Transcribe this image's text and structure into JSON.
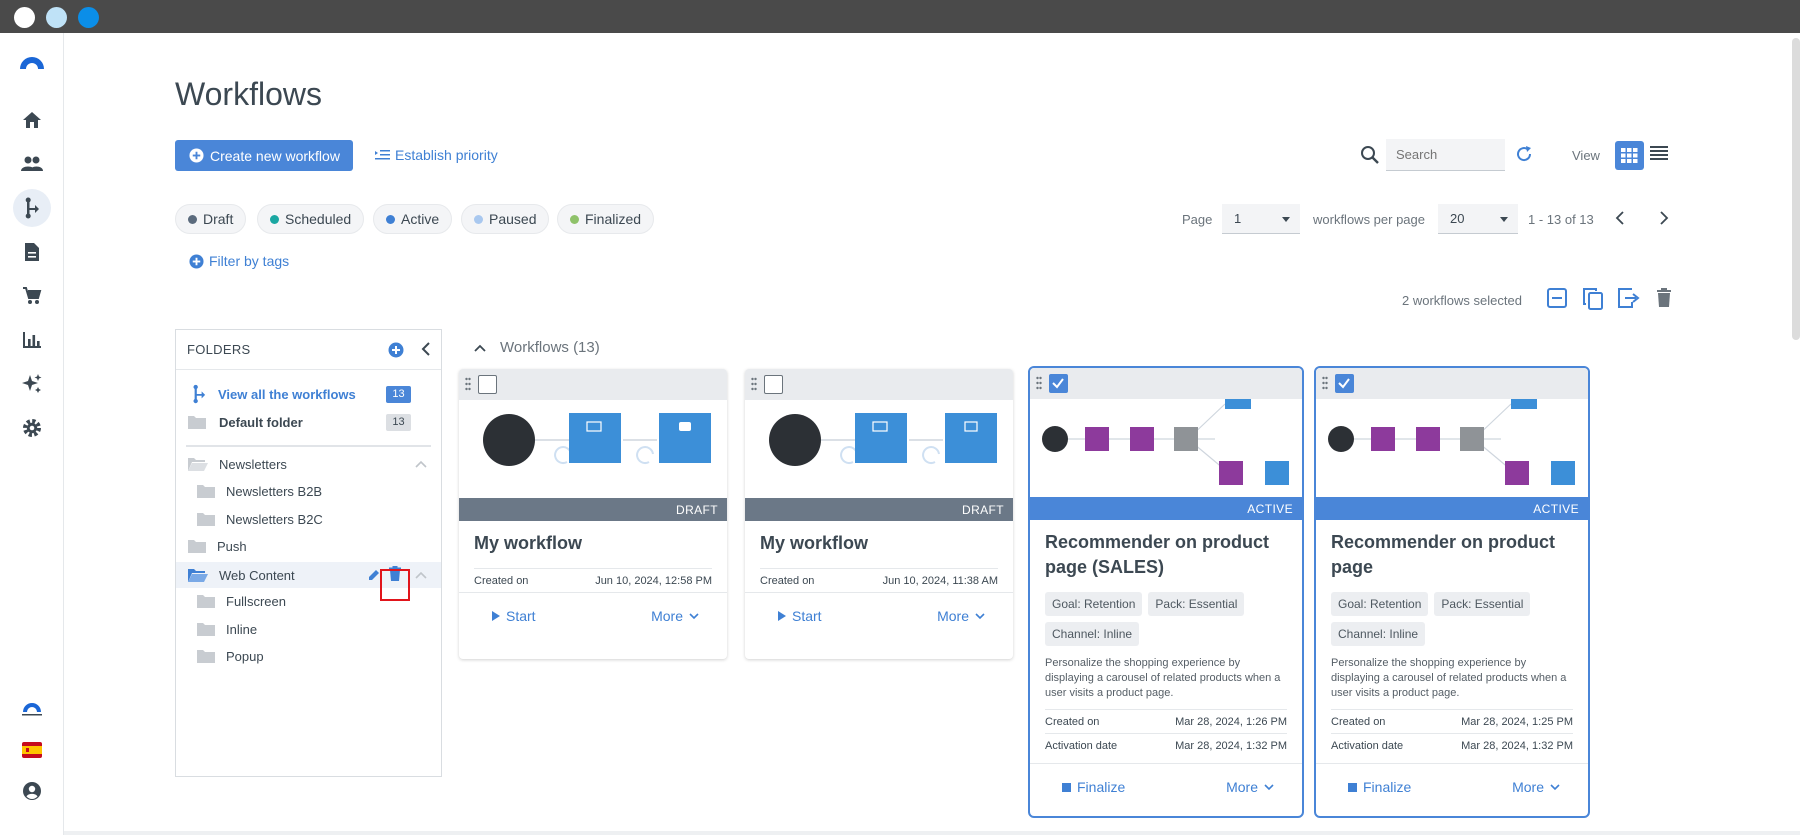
{
  "page": {
    "title": "Workflows"
  },
  "header": {
    "create_label": "Create new workflow",
    "priority_label": "Establish priority",
    "search_placeholder": "Search",
    "view_label": "View"
  },
  "status_filters": [
    {
      "label": "Draft",
      "color": "#5b6b7d"
    },
    {
      "label": "Scheduled",
      "color": "#1aa7a2"
    },
    {
      "label": "Active",
      "color": "#3f80d4"
    },
    {
      "label": "Paused",
      "color": "#a9c8ef"
    },
    {
      "label": "Finalized",
      "color": "#8fc26a"
    }
  ],
  "filter_tags_label": "Filter by tags",
  "pagination": {
    "page_label": "Page",
    "page_value": "1",
    "per_page_label": "workflows per page",
    "per_page_value": "20",
    "range": "1 - 13 of 13"
  },
  "selection": {
    "text": "2 workflows selected"
  },
  "folders": {
    "header": "FOLDERS",
    "view_all": {
      "label": "View all the workflows",
      "count": "13"
    },
    "default": {
      "label": "Default folder",
      "count": "13"
    },
    "items": [
      {
        "label": "Newsletters"
      },
      {
        "label": "Newsletters B2B"
      },
      {
        "label": "Newsletters B2C"
      },
      {
        "label": "Push"
      },
      {
        "label": "Web Content"
      },
      {
        "label": "Fullscreen"
      },
      {
        "label": "Inline"
      },
      {
        "label": "Popup"
      }
    ]
  },
  "workflows_section": {
    "title": "Workflows (13)"
  },
  "cards": [
    {
      "status": "DRAFT",
      "title": "My workflow",
      "created_label": "Created on",
      "created": "Jun 10, 2024, 12:58 PM",
      "primary_action": "Start",
      "more": "More"
    },
    {
      "status": "DRAFT",
      "title": "My workflow",
      "created_label": "Created on",
      "created": "Jun 10, 2024, 11:38 AM",
      "primary_action": "Start",
      "more": "More"
    },
    {
      "status": "ACTIVE",
      "title": "Recommender on product page (SALES)",
      "tags": [
        "Goal: Retention",
        "Pack: Essential",
        "Channel: Inline"
      ],
      "description": "Personalize the shopping experience by displaying a carousel of related products when a user visits a product page.",
      "created_label": "Created on",
      "created": "Mar 28, 2024, 1:26 PM",
      "activation_label": "Activation date",
      "activation": "Mar 28, 2024, 1:32 PM",
      "primary_action": "Finalize",
      "more": "More"
    },
    {
      "status": "ACTIVE",
      "title": "Recommender on product page",
      "tags": [
        "Goal: Retention",
        "Pack: Essential",
        "Channel: Inline"
      ],
      "description": "Personalize the shopping experience by displaying a carousel of related products when a user visits a product page.",
      "created_label": "Created on",
      "created": "Mar 28, 2024, 1:25 PM",
      "activation_label": "Activation date",
      "activation": "Mar 28, 2024, 1:32 PM",
      "primary_action": "Finalize",
      "more": "More"
    }
  ],
  "icons": {
    "nav": [
      "logo-icon",
      "home-icon",
      "contacts-icon",
      "workflows-icon",
      "templates-icon",
      "cart-icon",
      "reports-icon",
      "ai-sparkle-icon",
      "settings-icon"
    ],
    "accent": "#4a86d8"
  }
}
